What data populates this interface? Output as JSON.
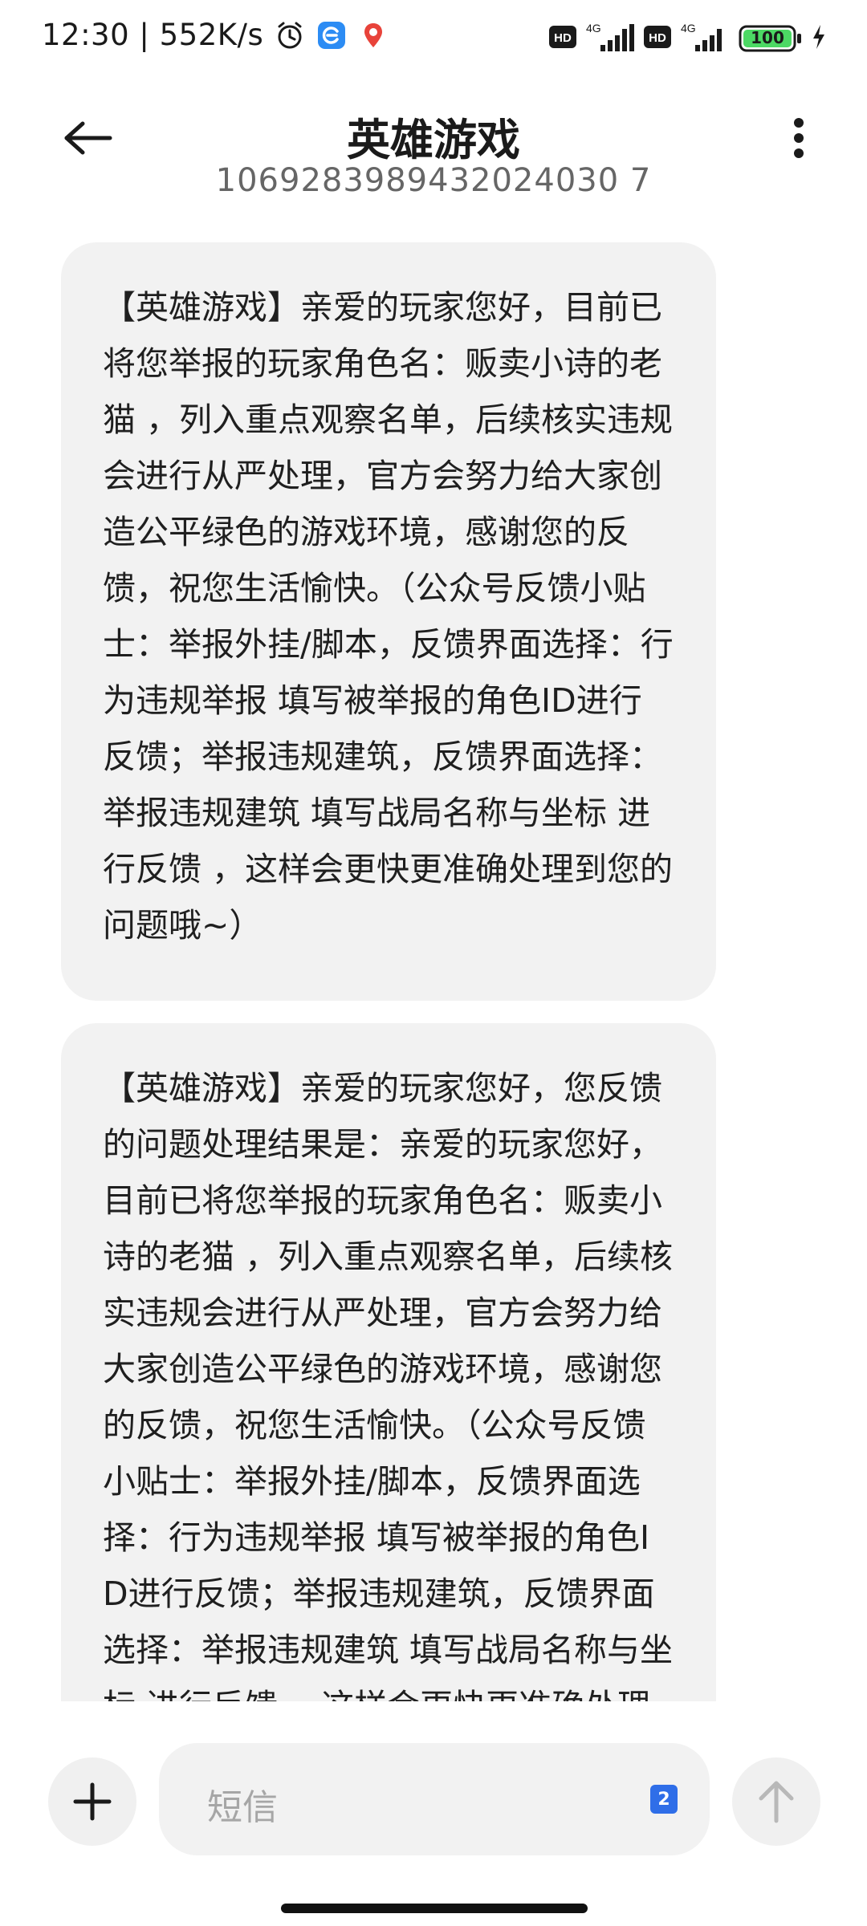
{
  "status_bar": {
    "time_and_speed": "12:30 | 552K/s",
    "icons": [
      "alarm-icon",
      "app-notification-icon",
      "location-pin-icon",
      "hd-icon",
      "signal-4g-icon",
      "battery-icon",
      "charging-icon"
    ],
    "network_1": "4G",
    "network_2": "4G",
    "hd_1": "HD",
    "hd_2": "HD",
    "battery_level": "100"
  },
  "header": {
    "title": "英雄游戏",
    "subtitle": "1069283989432024030 7"
  },
  "messages": [
    {
      "text": "【英雄游戏】亲爱的玩家您好，目前已将您举报的玩家角色名：贩卖小诗的老猫 ，列入重点观察名单，后续核实违规会进行从严处理，官方会努力给大家创造公平绿色的游戏环境，感谢您的反馈，祝您生活愉快。（公众号反馈小贴士：举报外挂/脚本，反馈界面选择：行为违规举报 填写被举报的角色ID进行反馈；举报违规建筑，反馈界面选择：举报违规建筑 填写战局名称与坐标 进行反馈 ，这样会更快更准确处理到您的问题哦~）"
    },
    {
      "text": "【英雄游戏】亲爱的玩家您好，您反馈的问题处理结果是：亲爱的玩家您好，目前已将您举报的玩家角色名：贩卖小诗的老猫 ，列入重点观察名单，后续核实违规会进行从严处理，官方会努力给大家创造公平绿色的游戏环境，感谢您的反馈，祝您生活愉快。（公众号反馈小贴士：举报外挂/脚本，反馈界面选择：行为违规举报 填写被举报的角色ID进行反馈；举报违规建筑，反馈界面选择：举报违规建筑 填写战局名称与坐标 进行反馈 ，这样会更快更准确处理到您的问题哦~）"
    }
  ],
  "input_bar": {
    "placeholder": "短信",
    "sim_badge": "2"
  },
  "colors": {
    "bubble_bg": "#f2f2f2",
    "sim_badge": "#2f6ee8",
    "placeholder": "#a6a6a6",
    "battery_fill": "#4cd964"
  }
}
